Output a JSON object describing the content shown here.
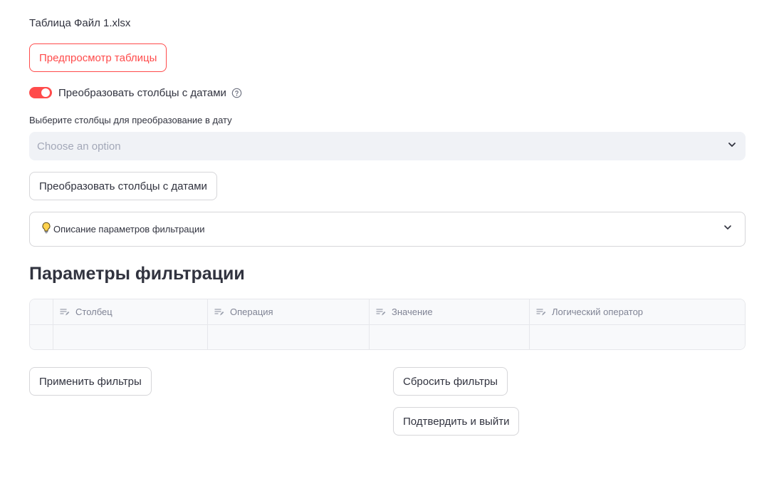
{
  "file_title": "Таблица Файл 1.xlsx",
  "preview_button": "Предпросмотр таблицы",
  "toggle": {
    "label": "Преобразовать столбцы с датами",
    "on": true
  },
  "select": {
    "label": "Выберите столбцы для преобразование в дату",
    "placeholder": "Choose an option"
  },
  "convert_button": "Преобразовать столбцы с датами",
  "expander": {
    "label": "Описание параметров фильтрации",
    "icon": "lightbulb-icon"
  },
  "section_heading": "Параметры фильтрации",
  "table": {
    "columns": [
      "Столбец",
      "Операция",
      "Значение",
      "Логический оператор"
    ],
    "rows": [
      [
        "",
        "",
        "",
        ""
      ]
    ]
  },
  "buttons": {
    "apply": "Применить фильтры",
    "reset": "Сбросить фильтры",
    "confirm": "Подтвердить и выйти"
  },
  "colors": {
    "accent": "#ff4b4b",
    "input_bg": "#f0f2f6",
    "text": "#31333f"
  }
}
